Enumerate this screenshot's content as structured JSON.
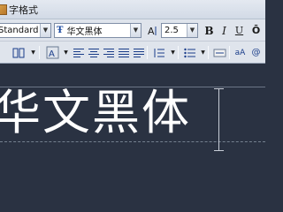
{
  "window": {
    "title": "字格式"
  },
  "toolbar": {
    "style_value": "Standard",
    "font_value": "华文黑体",
    "font_prefix_icon": "truetype-font-icon",
    "height_value": "2.5",
    "bold_label": "B",
    "italic_label": "I",
    "underline_label": "U",
    "stack_label": "b/a",
    "annotative_label": "A"
  },
  "editor": {
    "text": "华文黑体"
  }
}
